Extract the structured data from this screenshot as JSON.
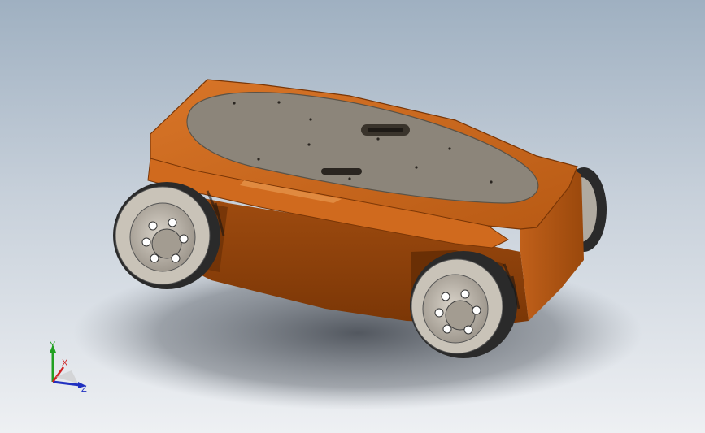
{
  "viewport": {
    "background_top": "#9fb0c1",
    "background_bottom": "#eef0f3"
  },
  "model": {
    "body_color": "#c8651a",
    "body_dark": "#8a3f0a",
    "plate_color": "#8c857a",
    "wheel_hub_color": "#b9b2a8",
    "roller_color": "#2a2a2a"
  },
  "triad": {
    "x_label": "X",
    "y_label": "Y",
    "z_label": "Z",
    "x_color": "#d02020",
    "y_color": "#20a020",
    "z_color": "#2030c0"
  }
}
